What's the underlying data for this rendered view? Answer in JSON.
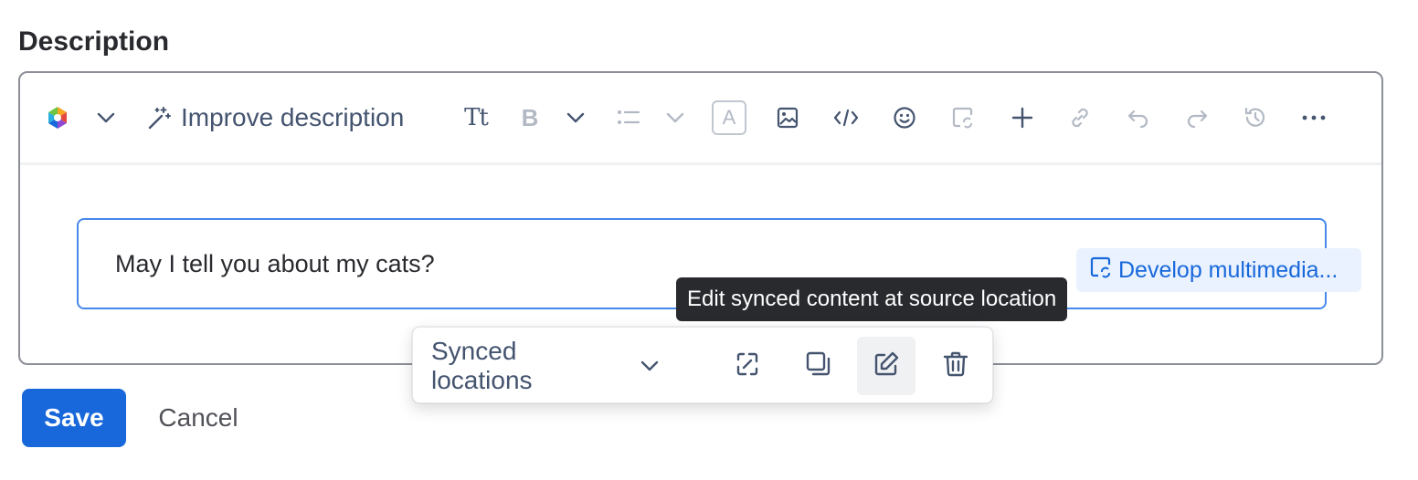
{
  "field": {
    "label": "Description"
  },
  "toolbar": {
    "ai_button_label": "Improve description",
    "text_style_label": "Tt",
    "bold_label": "B",
    "color_label": "A",
    "icons": [
      "ai-logo-icon",
      "chevron-down-icon",
      "magic-wand-icon",
      "text-style-icon",
      "bold-icon",
      "chevron-down-icon",
      "bullet-list-icon",
      "chevron-down-icon",
      "text-color-icon",
      "image-icon",
      "code-icon",
      "emoji-icon",
      "synced-block-icon",
      "plus-icon",
      "link-icon",
      "undo-icon",
      "redo-icon",
      "history-icon",
      "more-icon"
    ]
  },
  "content": {
    "synced_text": "May I tell you about my cats?",
    "develop_label": "Develop multimedia..."
  },
  "tooltip": {
    "text": "Edit synced content at source location"
  },
  "synced_toolbar": {
    "label": "Synced locations",
    "icons": [
      "chevron-down-icon",
      "unsync-icon",
      "copy-icon",
      "edit-icon",
      "delete-icon"
    ]
  },
  "actions": {
    "save_label": "Save",
    "cancel_label": "Cancel"
  },
  "colors": {
    "primary": "#1868DB",
    "border": "#8C8F97",
    "synced_border": "#4688EC",
    "pill_bg": "#E9F2FE",
    "tooltip_bg": "#292A2E"
  }
}
